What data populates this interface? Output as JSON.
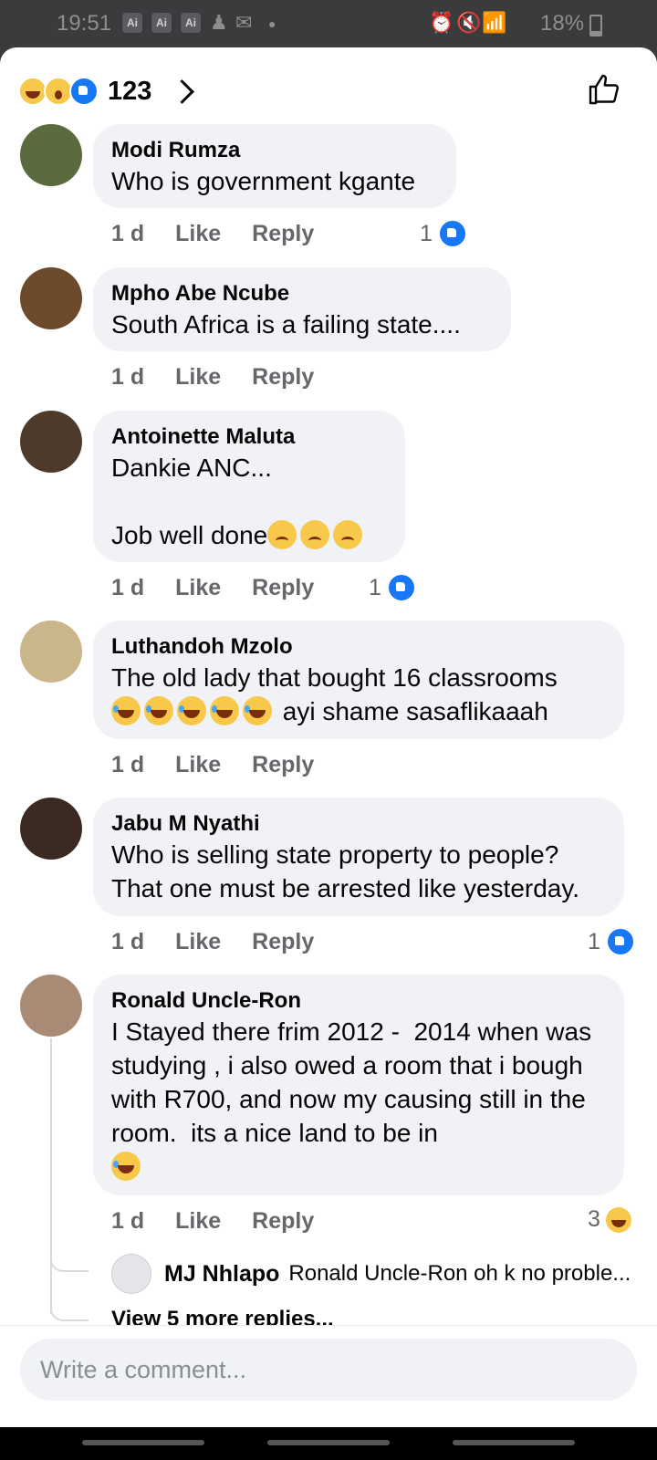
{
  "status_bar": {
    "time": "19:51",
    "ai_badges": [
      "Ai",
      "Ai",
      "Ai"
    ],
    "battery": "18%"
  },
  "header": {
    "reaction_count": "123",
    "reaction_icons": [
      "haha-icon",
      "wow-icon",
      "like-icon"
    ]
  },
  "comments": [
    {
      "author": "Modi Rumza",
      "text": "Who is government kgante",
      "time": "1 d",
      "like": "Like",
      "reply": "Reply",
      "reactions": "1",
      "reaction_icon": "like"
    },
    {
      "author": "Mpho Abe Ncube",
      "text": "South Africa is a failing state....",
      "time": "1 d",
      "like": "Like",
      "reply": "Reply"
    },
    {
      "author": "Antoinette Maluta",
      "text_line1": "Dankie ANC...",
      "text_line2": "Job well done",
      "time": "1 d",
      "like": "Like",
      "reply": "Reply",
      "reactions": "1",
      "reaction_icon": "like"
    },
    {
      "author": "Luthandoh Mzolo",
      "text_line1": "The old lady that bought 16 classrooms",
      "text_line2": " ayi shame sasaflikaaah",
      "time": "1 d",
      "like": "Like",
      "reply": "Reply"
    },
    {
      "author": "Jabu M Nyathi",
      "text": "Who is selling state property to people? That one must be arrested like yesterday.",
      "time": "1 d",
      "like": "Like",
      "reply": "Reply",
      "reactions": "1",
      "reaction_icon": "like"
    },
    {
      "author": "Ronald Uncle-Ron",
      "text": "I Stayed there frim 2012 -  2014 when was studying , i also owed a room that i bough with R700, and now my causing still in the room.  its a nice land to be in",
      "time": "1 d",
      "like": "Like",
      "reply": "Reply",
      "reactions": "3",
      "reaction_icon": "haha"
    }
  ],
  "reply_preview": {
    "author": "MJ Nhlapo",
    "text": "Ronald Uncle-Ron oh k no proble..."
  },
  "view_more": "View 5 more replies...",
  "composer": {
    "placeholder": "Write a comment..."
  }
}
